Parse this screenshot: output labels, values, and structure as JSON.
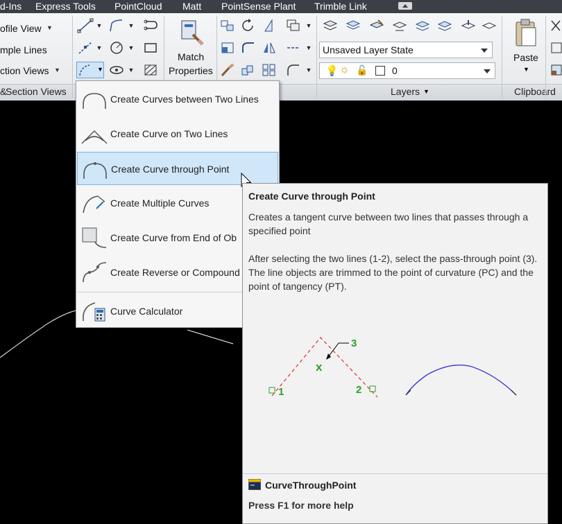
{
  "menubar": {
    "items": [
      "d-Ins",
      "Express Tools",
      "PointCloud",
      "Matt",
      "PointSense Plant",
      "Trimble Link"
    ]
  },
  "ribbon": {
    "left_panel": {
      "items": [
        "ofile View",
        "mple Lines",
        "ction Views"
      ],
      "title": "Section Views",
      "title_prefix": "&"
    },
    "match_properties": {
      "line1": "Match",
      "line2": "Properties"
    },
    "layers": {
      "state_combo": "Unsaved Layer State",
      "layer_combo": "0",
      "title": "Layers"
    },
    "clipboard": {
      "paste": "Paste",
      "title": "Clipboard"
    }
  },
  "menu": {
    "items": [
      {
        "label": "Create Curves between Two Lines",
        "icon": "curve-between-lines-icon",
        "selected": false
      },
      {
        "label": "Create Curve on Two Lines",
        "icon": "curve-on-two-lines-icon",
        "selected": false
      },
      {
        "label": "Create Curve through Point",
        "icon": "curve-through-point-icon",
        "selected": true
      },
      {
        "label": "Create Multiple Curves",
        "icon": "multiple-curves-icon",
        "selected": false
      },
      {
        "label": "Create Curve from End of Ob",
        "icon": "curve-from-end-icon",
        "selected": false
      },
      {
        "label": "Create Reverse or Compound",
        "icon": "reverse-compound-curve-icon",
        "selected": false
      },
      {
        "label": "Curve Calculator",
        "icon": "curve-calculator-icon",
        "selected": false
      }
    ]
  },
  "tooltip": {
    "title": "Create Curve through Point",
    "description": "Creates a tangent curve between two lines that passes through a specified point",
    "detail": "After selecting the two lines (1-2), select the pass-through point (3). The line objects are trimmed to the point of curvature (PC) and the point of tangency (PT).",
    "diagram_labels": [
      "1",
      "2",
      "3",
      "x"
    ],
    "command": "CurveThroughPoint",
    "help": "Press F1 for more help"
  },
  "colors": {
    "menubar_bg": "#3b3f46",
    "selected_bg": "#cfe7f9",
    "diagram_red": "#e53935",
    "diagram_green": "#2e9e2e",
    "diagram_blue": "#3b3bd6"
  }
}
